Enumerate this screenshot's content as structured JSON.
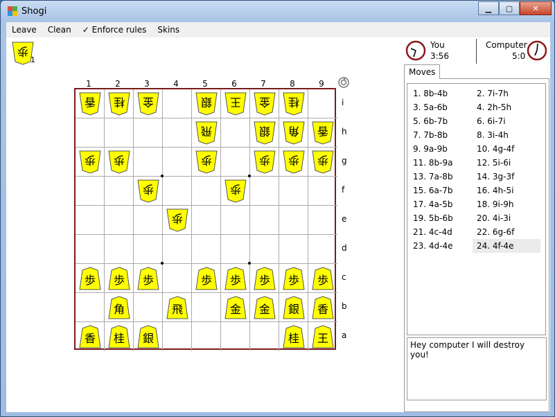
{
  "window": {
    "title": "Shogi"
  },
  "menu": [
    "Leave",
    "Clean",
    "✓ Enforce rules",
    "Skins"
  ],
  "captured": {
    "count": "1"
  },
  "board": {
    "files": [
      "1",
      "2",
      "3",
      "4",
      "5",
      "6",
      "7",
      "8",
      "9"
    ],
    "ranks": [
      "i",
      "h",
      "g",
      "f",
      "e",
      "d",
      "c",
      "b",
      "a"
    ],
    "pieces": [
      {
        "f": 0,
        "r": 0,
        "k": "香",
        "flip": true
      },
      {
        "f": 1,
        "r": 0,
        "k": "桂",
        "flip": true
      },
      {
        "f": 2,
        "r": 0,
        "k": "金",
        "flip": true
      },
      {
        "f": 4,
        "r": 0,
        "k": "銀",
        "flip": true
      },
      {
        "f": 5,
        "r": 0,
        "k": "王",
        "flip": true
      },
      {
        "f": 6,
        "r": 0,
        "k": "金",
        "flip": true
      },
      {
        "f": 7,
        "r": 0,
        "k": "桂",
        "flip": true
      },
      {
        "f": 4,
        "r": 1,
        "k": "飛",
        "flip": true
      },
      {
        "f": 6,
        "r": 1,
        "k": "銀",
        "flip": true
      },
      {
        "f": 7,
        "r": 1,
        "k": "角",
        "flip": true
      },
      {
        "f": 8,
        "r": 1,
        "k": "香",
        "flip": true
      },
      {
        "f": 0,
        "r": 2,
        "k": "歩",
        "flip": true
      },
      {
        "f": 1,
        "r": 2,
        "k": "歩",
        "flip": true
      },
      {
        "f": 4,
        "r": 2,
        "k": "歩",
        "flip": true
      },
      {
        "f": 6,
        "r": 2,
        "k": "歩",
        "flip": true
      },
      {
        "f": 7,
        "r": 2,
        "k": "歩",
        "flip": true
      },
      {
        "f": 8,
        "r": 2,
        "k": "歩",
        "flip": true
      },
      {
        "f": 2,
        "r": 3,
        "k": "歩",
        "flip": true
      },
      {
        "f": 5,
        "r": 3,
        "k": "歩",
        "flip": true
      },
      {
        "f": 3,
        "r": 4,
        "k": "歩",
        "flip": true
      },
      {
        "f": 0,
        "r": 6,
        "k": "歩",
        "flip": false
      },
      {
        "f": 1,
        "r": 6,
        "k": "歩",
        "flip": false
      },
      {
        "f": 2,
        "r": 6,
        "k": "歩",
        "flip": false
      },
      {
        "f": 4,
        "r": 6,
        "k": "歩",
        "flip": false
      },
      {
        "f": 5,
        "r": 6,
        "k": "歩",
        "flip": false
      },
      {
        "f": 6,
        "r": 6,
        "k": "歩",
        "flip": false
      },
      {
        "f": 7,
        "r": 6,
        "k": "歩",
        "flip": false
      },
      {
        "f": 8,
        "r": 6,
        "k": "歩",
        "flip": false
      },
      {
        "f": 1,
        "r": 7,
        "k": "角",
        "flip": false
      },
      {
        "f": 3,
        "r": 7,
        "k": "飛",
        "flip": false
      },
      {
        "f": 5,
        "r": 7,
        "k": "金",
        "flip": false
      },
      {
        "f": 6,
        "r": 7,
        "k": "金",
        "flip": false
      },
      {
        "f": 7,
        "r": 7,
        "k": "銀",
        "flip": false
      },
      {
        "f": 8,
        "r": 7,
        "k": "香",
        "flip": false
      },
      {
        "f": 0,
        "r": 8,
        "k": "香",
        "flip": false
      },
      {
        "f": 1,
        "r": 8,
        "k": "桂",
        "flip": false
      },
      {
        "f": 2,
        "r": 8,
        "k": "銀",
        "flip": false
      },
      {
        "f": 7,
        "r": 8,
        "k": "桂",
        "flip": false
      },
      {
        "f": 8,
        "r": 8,
        "k": "王",
        "flip": false
      }
    ]
  },
  "players": {
    "you": {
      "name": "You",
      "time": "3:56"
    },
    "computer": {
      "name": "Computer",
      "time": "5:0"
    }
  },
  "tab": {
    "label": "Moves"
  },
  "moves": [
    "1. 8b-4b",
    "2. 7i-7h",
    "3. 5a-6b",
    "4. 2h-5h",
    "5. 6b-7b",
    "6. 6i-7i",
    "7. 7b-8b",
    "8. 3i-4h",
    "9. 9a-9b",
    "10. 4g-4f",
    "11. 8b-9a",
    "12. 5i-6i",
    "13. 7a-8b",
    "14. 3g-3f",
    "15. 6a-7b",
    "16. 4h-5i",
    "17. 4a-5b",
    "18. 9i-9h",
    "19. 5b-6b",
    "20. 4i-3i",
    "21. 4c-4d",
    "22. 6g-6f",
    "23. 4d-4e",
    "24. 4f-4e"
  ],
  "chat": {
    "text": "Hey computer I will destroy you!"
  },
  "colors": {
    "piece": "#ffff00",
    "board_border": "#7a1a1a",
    "clock_ring": "#8b1a1a"
  }
}
